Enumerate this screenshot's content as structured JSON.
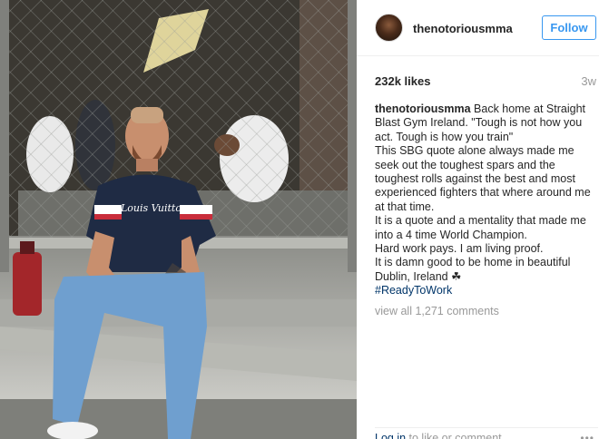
{
  "post": {
    "username": "thenotoriousmma",
    "follow_label": "Follow",
    "likes": "232k likes",
    "time_ago": "3w",
    "caption_username": "thenotoriousmma",
    "caption_text": " Back home at Straight Blast Gym Ireland. \"Tough is not how you act. Tough is how you train\"\nThis SBG quote alone always made me seek out the toughest spars and the toughest rolls against the best and most experienced fighters that where around me at that time.\nIt is a quote and a mentality that made me into a 4 time World Champion.\nHard work pays. I am living proof.\nIt is damn good to be home in beautiful Dublin, Ireland ☘",
    "hashtag": "#ReadyToWork",
    "view_comments": "view all 1,271 comments",
    "login_label": "Log in",
    "login_suffix": " to like or comment.",
    "more_icon": "more-horizontal-icon",
    "shirt_brand": "Louis Vuitton"
  },
  "colors": {
    "link_blue": "#3897f0",
    "hashtag": "#003569",
    "muted": "#999999",
    "text": "#262626"
  }
}
